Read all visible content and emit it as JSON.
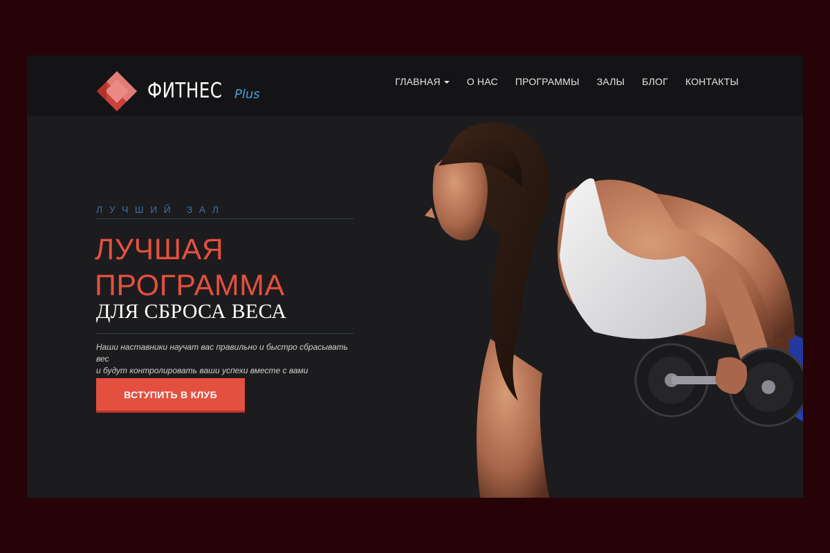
{
  "brand": {
    "name": "ФИТНЕС",
    "suffix": "Plus",
    "colors": {
      "accent": "#e4503f",
      "blue": "#4a9fd8",
      "background": "#1c1c1e",
      "navbar": "#141416"
    }
  },
  "nav": {
    "items": [
      {
        "label": "ГЛАВНАЯ",
        "has_dropdown": true
      },
      {
        "label": "О НАС"
      },
      {
        "label": "ПРОГРАММЫ"
      },
      {
        "label": "ЗАЛЫ"
      },
      {
        "label": "БЛОГ"
      },
      {
        "label": "КОНТАКТЫ"
      }
    ]
  },
  "hero": {
    "eyebrow": "ЛУЧШИЙ ЗАЛ",
    "headline_line1": "ЛУЧШАЯ",
    "headline_line2": "ПРОГРАММА",
    "subhead": "ДЛЯ СБРОСА ВЕСА",
    "description_line1": "Наши наставники научат вас правильно и быстро сбрасывать вес",
    "description_line2": "и будут контролировать ваши успехи вместе с вами",
    "cta_label": "ВСТУПИТЬ В КЛУБ"
  }
}
